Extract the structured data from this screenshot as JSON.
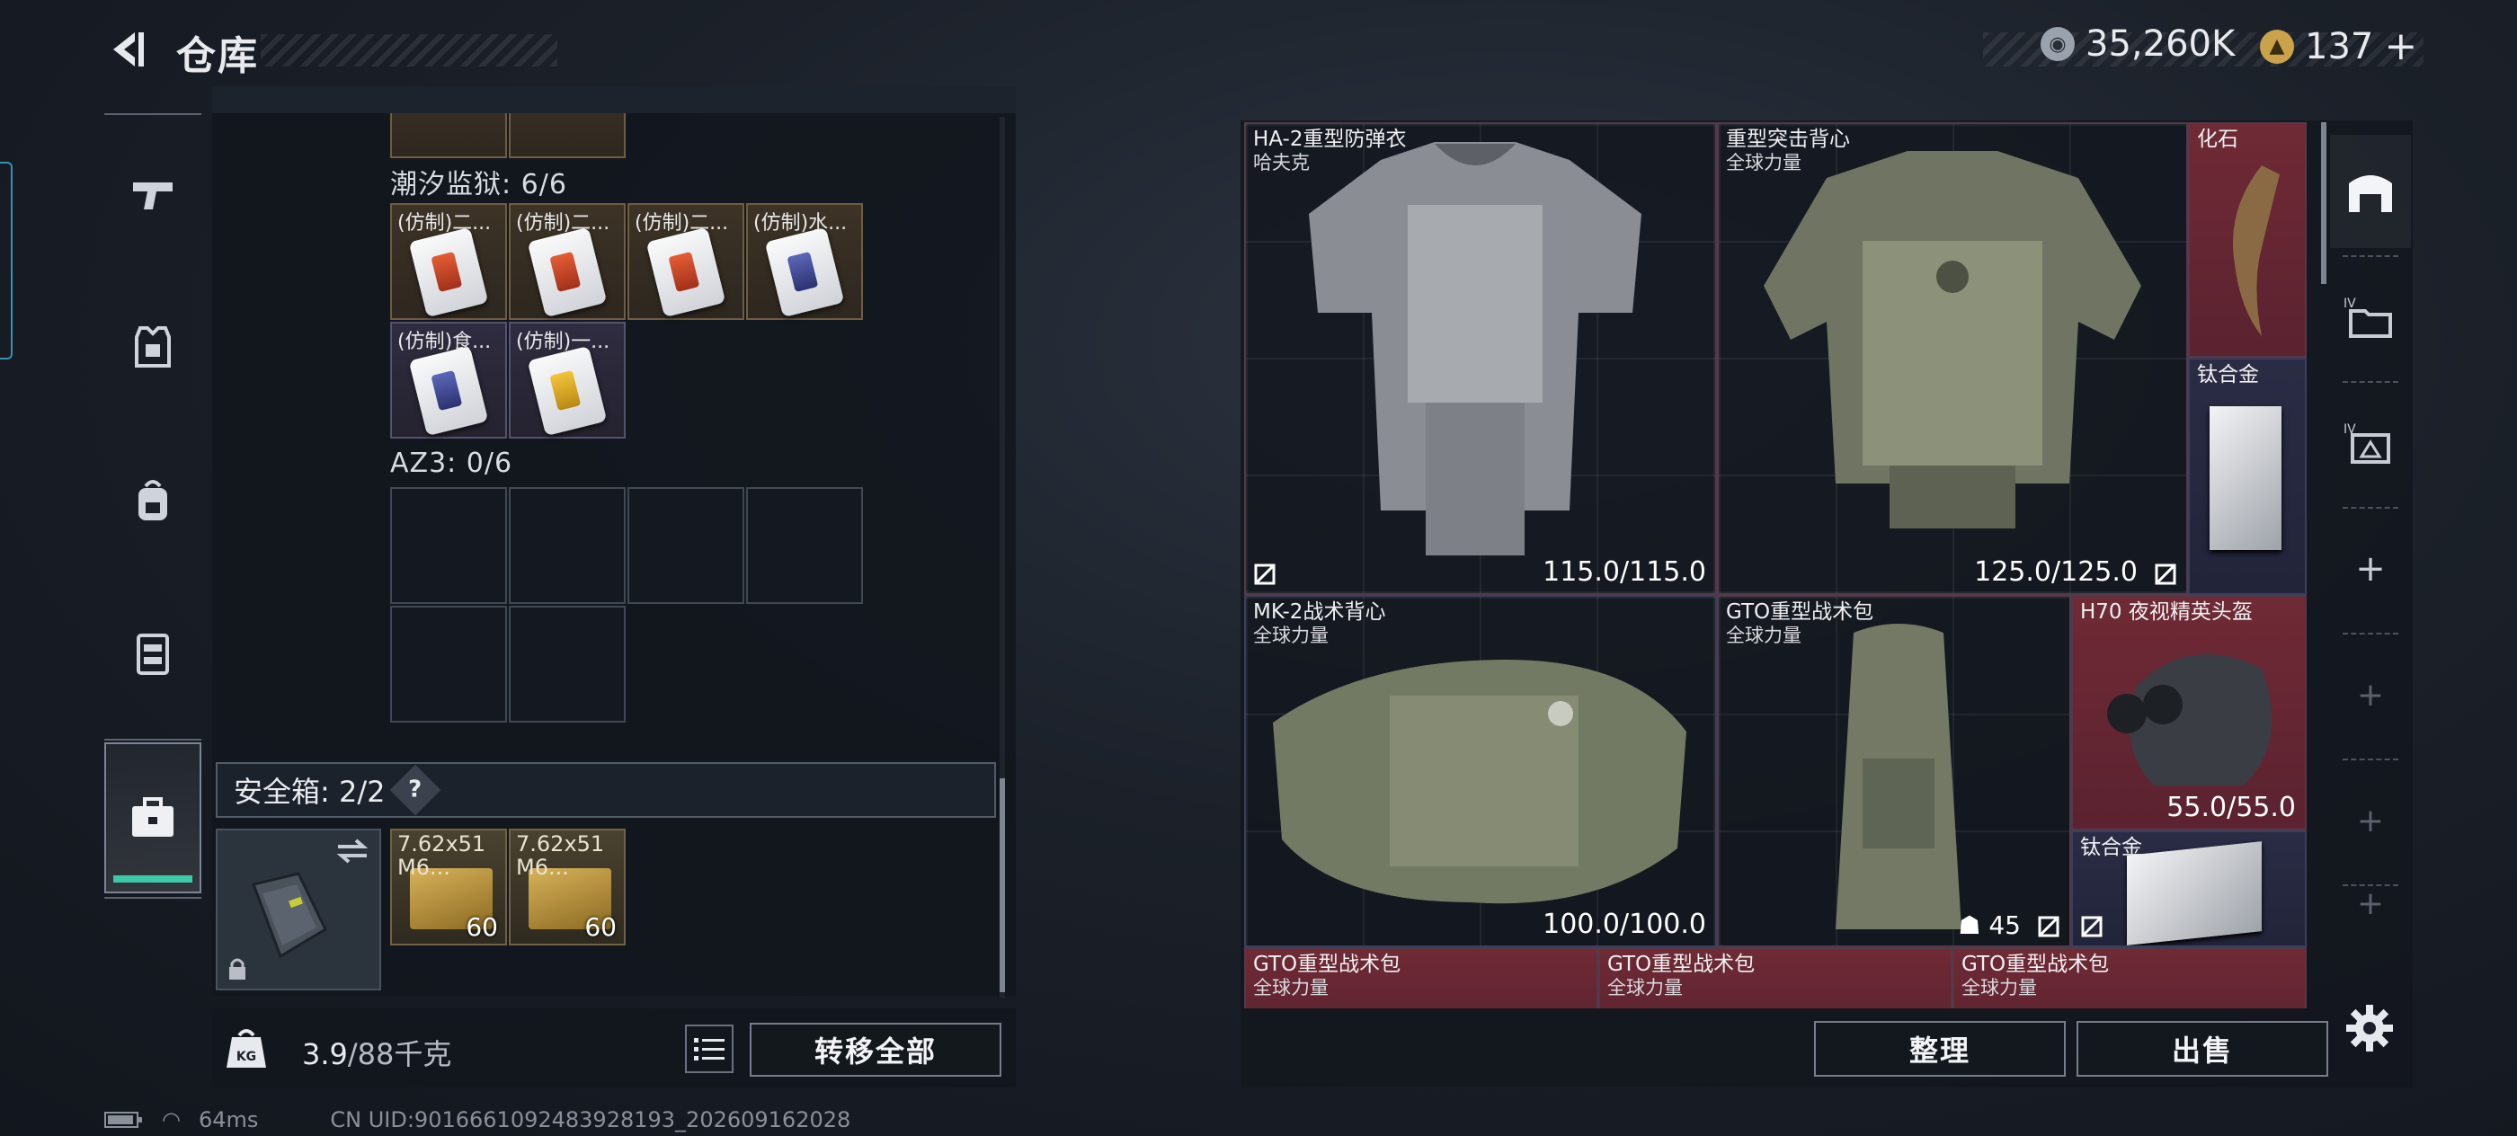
{
  "header": {
    "title": "仓库",
    "silver_amount": "35,260K",
    "gold_amount": "137",
    "gold_add": "+"
  },
  "left_nav": [
    "weapon-icon",
    "armor-icon",
    "backpack-icon",
    "rig-icon",
    "safebox-icon"
  ],
  "container": {
    "section1_label": "潮汐监狱: 6/6",
    "section1_items": [
      {
        "name": "(仿制)二...",
        "color": "red",
        "rarity": "orange"
      },
      {
        "name": "(仿制)二...",
        "color": "red",
        "rarity": "orange"
      },
      {
        "name": "(仿制)二...",
        "color": "red",
        "rarity": "orange"
      },
      {
        "name": "(仿制)水...",
        "color": "blue",
        "rarity": "orange"
      },
      {
        "name": "(仿制)食...",
        "color": "blue",
        "rarity": "purple"
      },
      {
        "name": "(仿制)一...",
        "color": "yellow",
        "rarity": "purple"
      }
    ],
    "section2_label": "AZ3: 0/6"
  },
  "safebox": {
    "label": "安全箱: 2/2",
    "help": "?",
    "items": [
      {
        "name": "7.62x51 M6...",
        "count": "60"
      },
      {
        "name": "7.62x51 M6...",
        "count": "60"
      }
    ]
  },
  "footer_left": {
    "weight_current": "3.9",
    "weight_max": "/88千克",
    "transfer_all": "转移全部"
  },
  "stash": {
    "items": [
      {
        "name": "HA-2重型防弹衣",
        "sub": "哈夫克",
        "durability": "115.0/115.0"
      },
      {
        "name": "重型突击背心",
        "sub": "全球力量",
        "durability": "125.0/125.0"
      },
      {
        "name": "化石",
        "sub": "",
        "durability": ""
      },
      {
        "name": "钛合金",
        "sub": "",
        "durability": ""
      },
      {
        "name": "MK-2战术背心",
        "sub": "全球力量",
        "durability": "100.0/100.0"
      },
      {
        "name": "GTO重型战术包",
        "sub": "全球力量",
        "durability": ""
      },
      {
        "name": "H70 夜视精英头盔",
        "sub": "",
        "durability": "55.0/55.0"
      },
      {
        "name": "钛合金",
        "sub": "",
        "durability": ""
      },
      {
        "name": "GTO重型战术包",
        "sub": "全球力量",
        "durability": ""
      },
      {
        "name": "GTO重型战术包",
        "sub": "全球力量",
        "durability": ""
      },
      {
        "name": "GTO重型战术包",
        "sub": "全球力量",
        "durability": ""
      }
    ],
    "backpack_capacity": "45"
  },
  "footer_right": {
    "sort": "整理",
    "sell": "出售"
  },
  "status_bar": {
    "ping": "64ms",
    "uid": "CN UID:9016661092483928193_202609162028"
  },
  "colors": {
    "accent_green": "#3cc9a8",
    "rarity_red": "#6f2a35",
    "rarity_navy": "#2a2c45"
  }
}
